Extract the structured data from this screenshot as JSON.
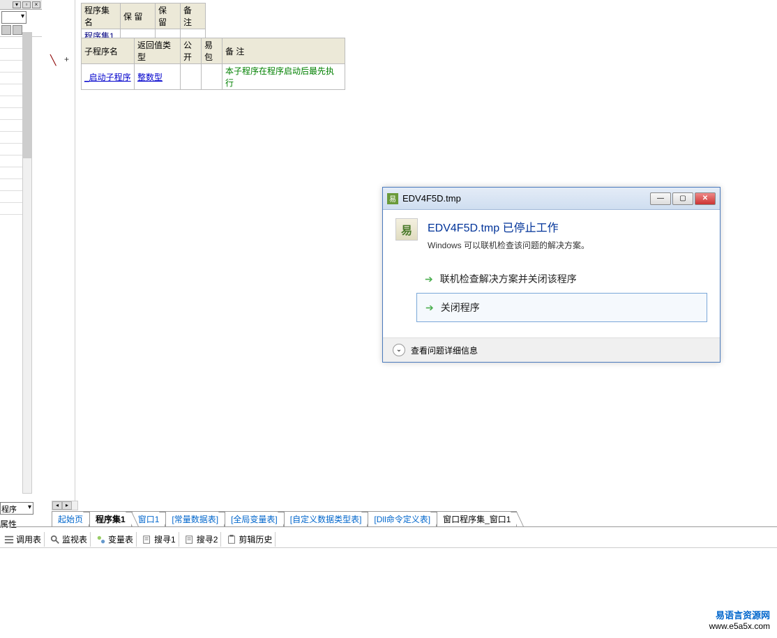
{
  "left": {
    "bottom_select": "程序",
    "prop_label": "属性"
  },
  "table1": {
    "headers": [
      "程序集名",
      "保 留",
      "保 留",
      "备 注"
    ],
    "rows": [
      {
        "name": "程序集1",
        "c1": "",
        "c2": "",
        "c3": ""
      }
    ]
  },
  "table2": {
    "headers": [
      "子程序名",
      "返回值类型",
      "公开",
      "易包",
      "备 注"
    ],
    "rows": [
      {
        "name": "_启动子程序",
        "rtype": "整数型",
        "pub": "",
        "pkg": "",
        "note": "本子程序在程序启动后最先执行"
      }
    ]
  },
  "tabs": [
    {
      "label": "起始页",
      "active": false,
      "accent": true
    },
    {
      "label": "程序集1",
      "active": true,
      "accent": false
    },
    {
      "label": "窗口1",
      "active": false,
      "accent": true
    },
    {
      "label": "[常量数据表]",
      "active": false,
      "accent": true
    },
    {
      "label": "[全局变量表]",
      "active": false,
      "accent": true
    },
    {
      "label": "[自定义数据类型表]",
      "active": false,
      "accent": true
    },
    {
      "label": "[Dll命令定义表]",
      "active": false,
      "accent": true
    },
    {
      "label": "窗口程序集_窗口1",
      "active": false,
      "accent": false
    }
  ],
  "status": [
    {
      "label": "调用表"
    },
    {
      "label": "监视表"
    },
    {
      "label": "变量表"
    },
    {
      "label": "搜寻1"
    },
    {
      "label": "搜寻2"
    },
    {
      "label": "剪辑历史"
    }
  ],
  "dialog": {
    "title": "EDV4F5D.tmp",
    "main": "EDV4F5D.tmp 已停止工作",
    "sub": "Windows 可以联机检查该问题的解决方案。",
    "option1": "联机检查解决方案并关闭该程序",
    "option2": "关闭程序",
    "details": "查看问题详细信息"
  },
  "watermark": {
    "cn": "易语言资源网",
    "en": "www.e5a5x.com"
  }
}
